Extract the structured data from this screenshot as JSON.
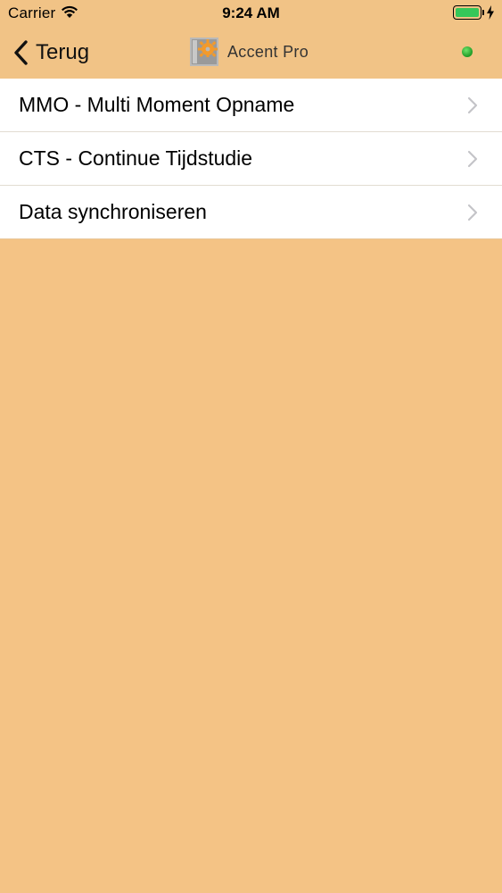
{
  "status_bar": {
    "carrier": "Carrier",
    "time": "9:24 AM",
    "battery_level": 1.0,
    "charging": true,
    "wifi_icon": "wifi-icon",
    "battery_color": "#35c759"
  },
  "nav": {
    "back_label": "Terug",
    "title": "Accent Pro",
    "logo_icon": "gear-logo-icon",
    "status_color": "#2db52d"
  },
  "menu": {
    "items": [
      {
        "label": "MMO - Multi Moment Opname"
      },
      {
        "label": "CTS - Continue Tijdstudie"
      },
      {
        "label": "Data synchroniseren"
      }
    ]
  },
  "colors": {
    "background": "#f4c385",
    "bar": "#f1c386",
    "accent": "#f39a2b"
  }
}
